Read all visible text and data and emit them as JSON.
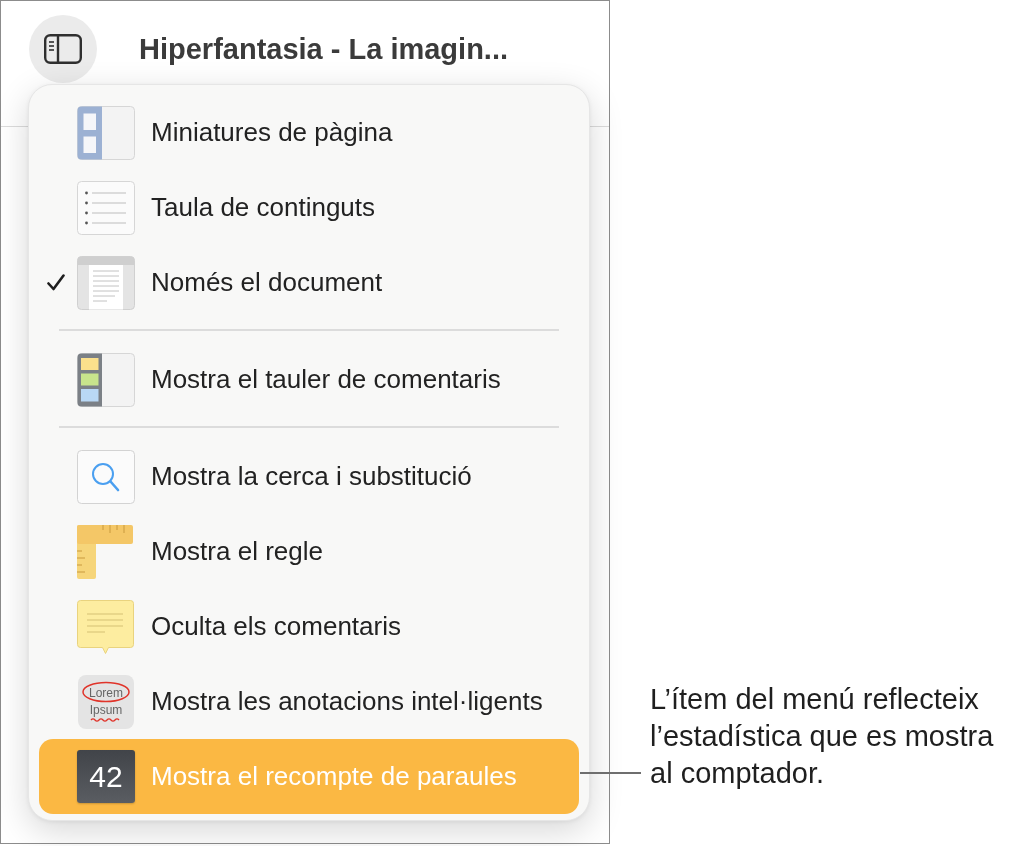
{
  "header": {
    "sidebar_button": {
      "active": true
    },
    "title": "Hiperfantasia - La imagin..."
  },
  "menu": {
    "sections": [
      {
        "items": [
          {
            "kind": "thumbnails",
            "label": "Miniatures de pàgina",
            "checked": false,
            "selected": false
          },
          {
            "kind": "toc",
            "label": "Taula de continguts",
            "checked": false,
            "selected": false
          },
          {
            "kind": "document",
            "label": "Només el document",
            "checked": true,
            "selected": false
          }
        ]
      },
      {
        "items": [
          {
            "kind": "pane",
            "label": "Mostra el tauler de comentaris",
            "checked": false,
            "selected": false
          }
        ]
      },
      {
        "items": [
          {
            "kind": "search",
            "label": "Mostra la cerca i substitució",
            "checked": false,
            "selected": false
          },
          {
            "kind": "ruler",
            "label": "Mostra el regle",
            "checked": false,
            "selected": false
          },
          {
            "kind": "note",
            "label": "Oculta els comentaris",
            "checked": false,
            "selected": false
          },
          {
            "kind": "annotations",
            "label": "Mostra les anotacions intel·ligents",
            "checked": false,
            "selected": false,
            "icon_text": [
              "Lorem",
              "Ipsum"
            ]
          },
          {
            "kind": "count",
            "label": "Mostra el recompte de paraules",
            "checked": false,
            "selected": true,
            "badge": "42"
          }
        ]
      }
    ]
  },
  "callout": {
    "text": "L’ítem del menú reflecteix l’estadística que es mostra al comptador."
  }
}
